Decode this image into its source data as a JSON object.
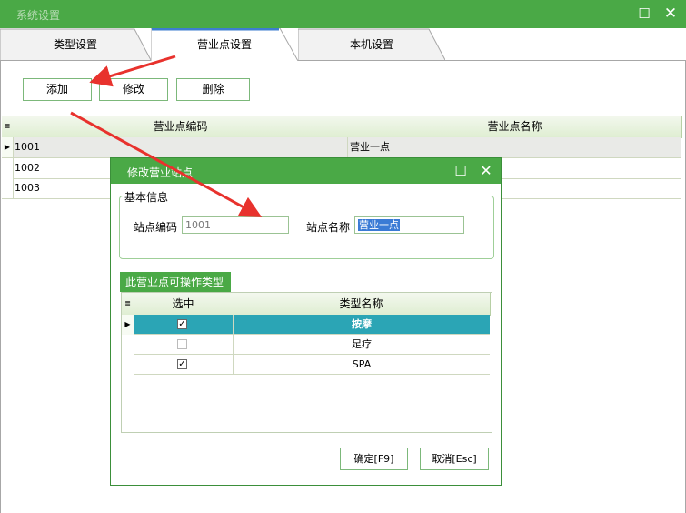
{
  "window": {
    "title": "系统设置"
  },
  "tabs": [
    {
      "label": "类型设置",
      "active": false
    },
    {
      "label": "营业点设置",
      "active": true
    },
    {
      "label": "本机设置",
      "active": false
    }
  ],
  "toolbar": {
    "add_label": "添加",
    "edit_label": "修改",
    "delete_label": "删除"
  },
  "outlet_grid": {
    "columns": [
      "营业点编码",
      "营业点名称"
    ],
    "rows": [
      {
        "code": "1001",
        "name": "营业一点",
        "selected": true
      },
      {
        "code": "1002",
        "name": ""
      },
      {
        "code": "1003",
        "name": ""
      }
    ]
  },
  "dialog": {
    "title": "修改营业站点",
    "basic_group": "基本信息",
    "code_label": "站点编码",
    "code_value": "1001",
    "name_label": "站点名称",
    "name_value": "营业一点",
    "types_caption": "此营业点可操作类型",
    "types_columns": [
      "选中",
      "类型名称"
    ],
    "types_rows": [
      {
        "checked": true,
        "name": "按摩",
        "selected": true
      },
      {
        "checked": false,
        "name": "足疗"
      },
      {
        "checked": true,
        "name": "SPA"
      }
    ],
    "ok_label": "确定[F9]",
    "cancel_label": "取消[Esc]"
  },
  "colors": {
    "title_bar": "#4aa946",
    "selected_row": "#2ba5b5",
    "arrow": "#e8322d"
  }
}
